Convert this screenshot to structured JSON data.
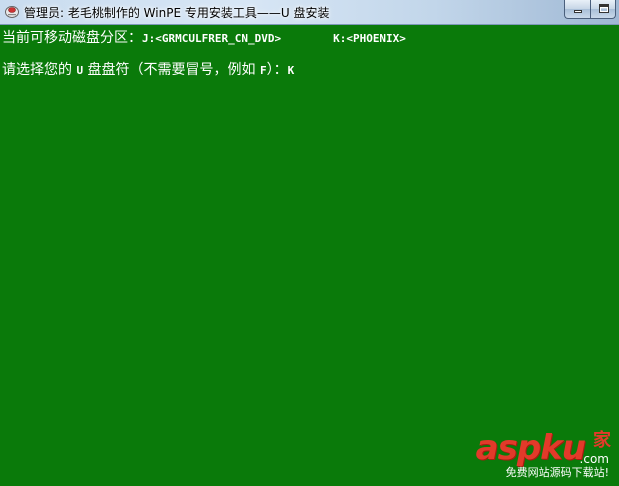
{
  "window": {
    "title": "管理员: 老毛桃制作的 WinPE 专用安装工具——U 盘安装",
    "icon": "console-app-icon"
  },
  "console": {
    "line1_prefix": "当前可移动磁盘分区：",
    "partitions": [
      "J:<GRMCULFRER_CN_DVD>",
      "K:<PHOENIX>"
    ],
    "line2_prompt": "请选择您的 ",
    "line2_u": "U",
    "line2_mid": " 盘盘符（不需要冒号，例如 ",
    "line2_f": "F",
    "line2_end": "）：",
    "line2_input": "K"
  },
  "watermark": {
    "logo": "aspku",
    "logo_suffix": "家",
    "domain": ".com",
    "slogan": "免费网站源码下载站!"
  },
  "colors": {
    "console_bg": "#0a7a0a",
    "console_text": "#ffffff",
    "watermark_red": "#e23a2a"
  }
}
